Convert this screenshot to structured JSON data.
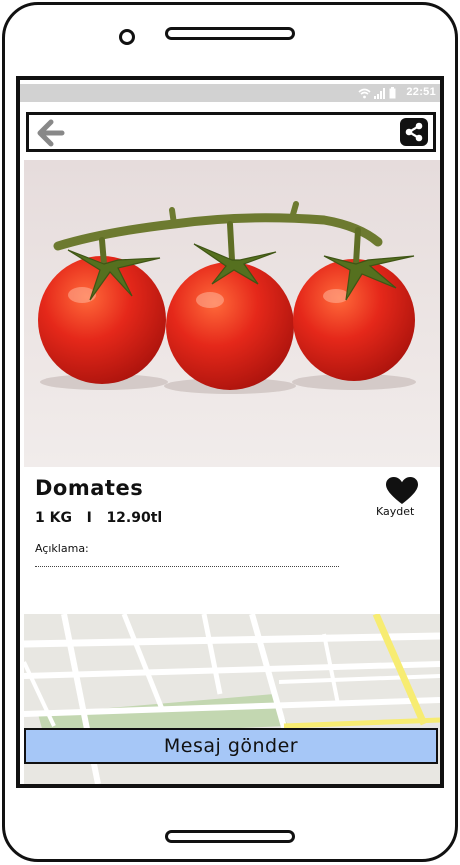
{
  "status_bar": {
    "time": "22:51",
    "icons": [
      "wifi-icon",
      "signal-icon",
      "battery-icon"
    ]
  },
  "top_bar": {
    "back_icon": "arrow-left-icon",
    "share_icon": "share-icon"
  },
  "product": {
    "title": "Domates",
    "quantity": "1 KG",
    "separator": "I",
    "price": "12.90tl",
    "favorite_label": "Kaydet",
    "favorite_icon": "heart-icon",
    "description_label": "Açıklama:"
  },
  "actions": {
    "send_message_label": "Mesaj gönder"
  },
  "colors": {
    "button_blue": "#a6c7f7",
    "status_bar_gray": "#d2d2d2",
    "map_road_yellow": "#f7ec72",
    "map_park_green": "#c3d7b1"
  }
}
